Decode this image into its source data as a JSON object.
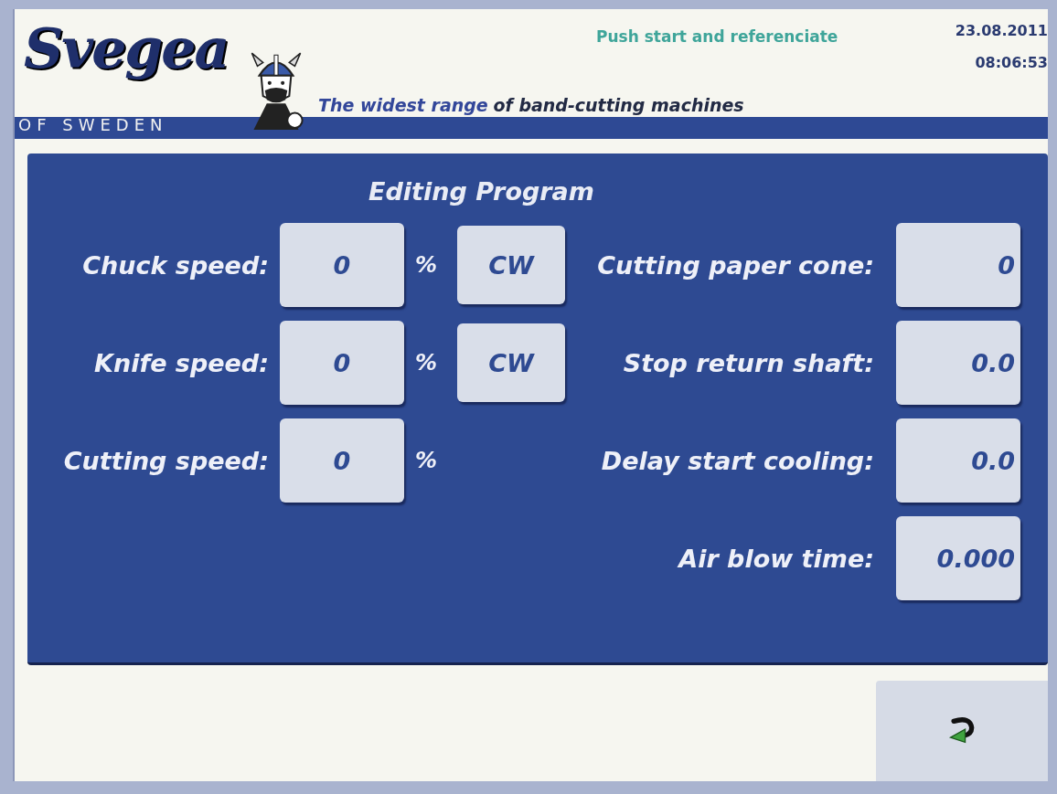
{
  "header": {
    "logo_name": "Svegea",
    "logo_subtitle": "OF SWEDEN",
    "tagline_highlight": "The widest range",
    "tagline_rest": "of band-cutting machines",
    "status_message": "Push start and referenciate",
    "date": "23.08.2011",
    "time": "08:06:53"
  },
  "panel": {
    "title": "Editing Program",
    "left_fields": [
      {
        "label": "Chuck speed:",
        "value": "0",
        "unit": "%",
        "direction": "CW"
      },
      {
        "label": "Knife speed:",
        "value": "0",
        "unit": "%",
        "direction": "CW"
      },
      {
        "label": "Cutting speed:",
        "value": "0",
        "unit": "%"
      }
    ],
    "right_fields": [
      {
        "label": "Cutting paper cone:",
        "value": "0"
      },
      {
        "label": "Stop return shaft:",
        "value": "0.0"
      },
      {
        "label": "Delay start cooling:",
        "value": "0.0"
      },
      {
        "label": "Air blow time:",
        "value": "0.000"
      }
    ]
  }
}
